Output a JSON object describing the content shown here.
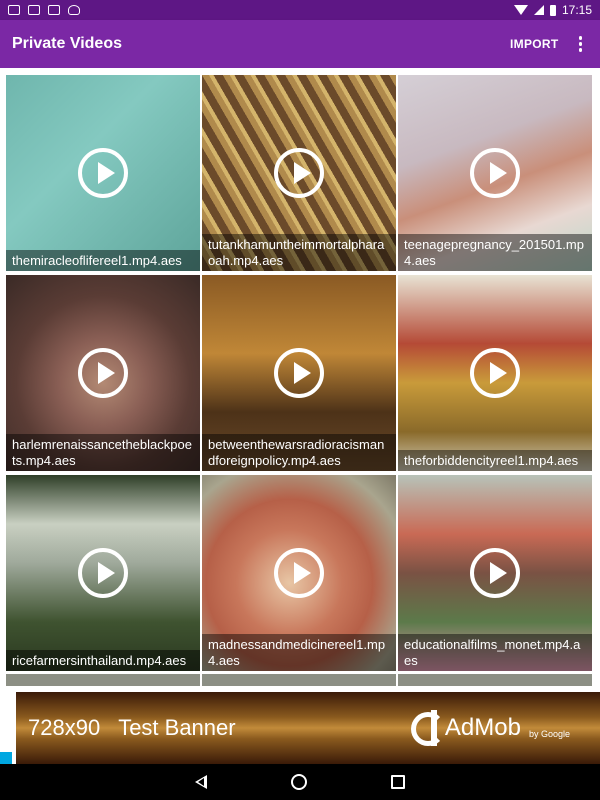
{
  "status_bar": {
    "time": "17:15",
    "left_icons": [
      "mail-icon",
      "mail-icon",
      "image-icon",
      "android-icon"
    ],
    "right_icons": [
      "wifi-icon",
      "signal-icon",
      "battery-icon"
    ]
  },
  "app_bar": {
    "title": "Private Videos",
    "import_label": "IMPORT",
    "overflow_icon": "more-vert-icon",
    "color": "#7b28a5",
    "status_color": "#5e1785"
  },
  "videos": [
    {
      "caption": "themiracleoflifereel1.mp4.aes"
    },
    {
      "caption": "tutankhamuntheimmortalpharaoah.mp4.aes"
    },
    {
      "caption": "teenagepregnancy_201501.mp4.aes"
    },
    {
      "caption": "harlemrenaissancetheblackpoets.mp4.aes"
    },
    {
      "caption": "betweenthewarsradioracismandforeignpolicy.mp4.aes"
    },
    {
      "caption": "theforbiddencityreel1.mp4.aes"
    },
    {
      "caption": "ricefarmersinthailand.mp4.aes"
    },
    {
      "caption": "madnessandmedicinereel1.mp4.aes"
    },
    {
      "caption": "educationalfilms_monet.mp4.aes"
    }
  ],
  "ad": {
    "size": "728x90",
    "label": "Test Banner",
    "brand": "AdMob",
    "brand_sub": "by Google"
  },
  "nav": {
    "icons": [
      "back-icon",
      "home-icon",
      "recents-icon"
    ]
  }
}
